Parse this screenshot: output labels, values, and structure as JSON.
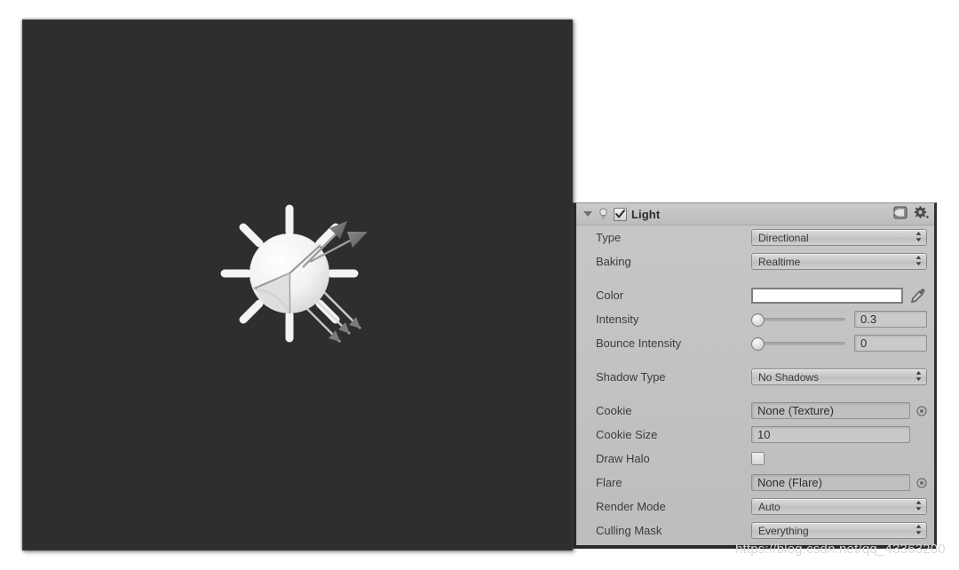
{
  "scene": {
    "name": "scene-view",
    "background_color": "#2e2e2e",
    "gizmo": {
      "name": "directional-light-gizmo",
      "description": "Sun icon with 8 rays, shaded sphere and three direction arrows"
    }
  },
  "inspector": {
    "header": {
      "title": "Light",
      "enabled": true,
      "foldout_open": true,
      "icons": {
        "foldout": "triangle-down-icon",
        "component": "light-bulb-icon",
        "enabled_checkbox": "checkbox-checked-icon",
        "reference": "book-icon",
        "settings": "gear-icon"
      }
    },
    "fields": [
      {
        "label": "Type",
        "kind": "dropdown",
        "value": "Directional",
        "group": 0
      },
      {
        "label": "Baking",
        "kind": "dropdown",
        "value": "Realtime",
        "group": 0
      },
      {
        "label": "Color",
        "kind": "color",
        "value": "#ffffff",
        "group": 1
      },
      {
        "label": "Intensity",
        "kind": "slider",
        "value": "0.3",
        "slider_pct": 2,
        "group": 1
      },
      {
        "label": "Bounce Intensity",
        "kind": "slider",
        "value": "0",
        "slider_pct": 2,
        "group": 1
      },
      {
        "label": "Shadow Type",
        "kind": "dropdown",
        "value": "No Shadows",
        "group": 2
      },
      {
        "label": "Cookie",
        "kind": "object",
        "value": "None (Texture)",
        "group": 3
      },
      {
        "label": "Cookie Size",
        "kind": "text",
        "value": "10",
        "group": 3
      },
      {
        "label": "Draw Halo",
        "kind": "checkbox",
        "value": false,
        "group": 3
      },
      {
        "label": "Flare",
        "kind": "object",
        "value": "None (Flare)",
        "group": 3
      },
      {
        "label": "Render Mode",
        "kind": "dropdown",
        "value": "Auto",
        "group": 3
      },
      {
        "label": "Culling Mask",
        "kind": "dropdown",
        "value": "Everything",
        "group": 3
      }
    ],
    "stepper_glyph": "⇕",
    "colors": {
      "panel_bg": "#c2c2c2",
      "label_text": "#3c3c3c",
      "field_bg": "#c8c8c8"
    }
  },
  "watermark": {
    "text": "https://blog.csdn.net/qq_43363200"
  }
}
